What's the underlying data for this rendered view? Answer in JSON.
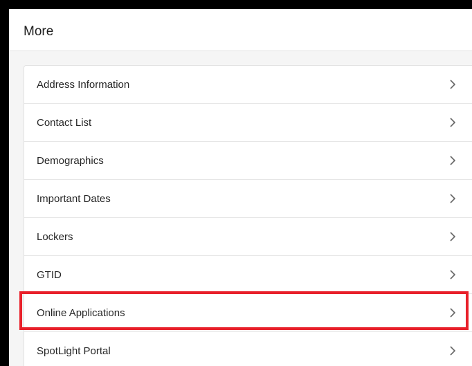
{
  "header": {
    "title": "More"
  },
  "menu": {
    "items": [
      {
        "label": "Address Information",
        "icon": "chevron-right-icon"
      },
      {
        "label": "Contact List",
        "icon": "chevron-right-icon"
      },
      {
        "label": "Demographics",
        "icon": "chevron-right-icon"
      },
      {
        "label": "Important Dates",
        "icon": "chevron-right-icon"
      },
      {
        "label": "Lockers",
        "icon": "chevron-right-icon"
      },
      {
        "label": "GTID",
        "icon": "chevron-right-icon"
      },
      {
        "label": "Online Applications",
        "icon": "chevron-right-icon",
        "highlighted": true
      },
      {
        "label": "SpotLight Portal",
        "icon": "chevron-right-icon"
      }
    ]
  },
  "colors": {
    "highlight": "#e8202a",
    "page_background": "#f5f5f5",
    "card_background": "#ffffff",
    "outer_border": "#000000"
  }
}
